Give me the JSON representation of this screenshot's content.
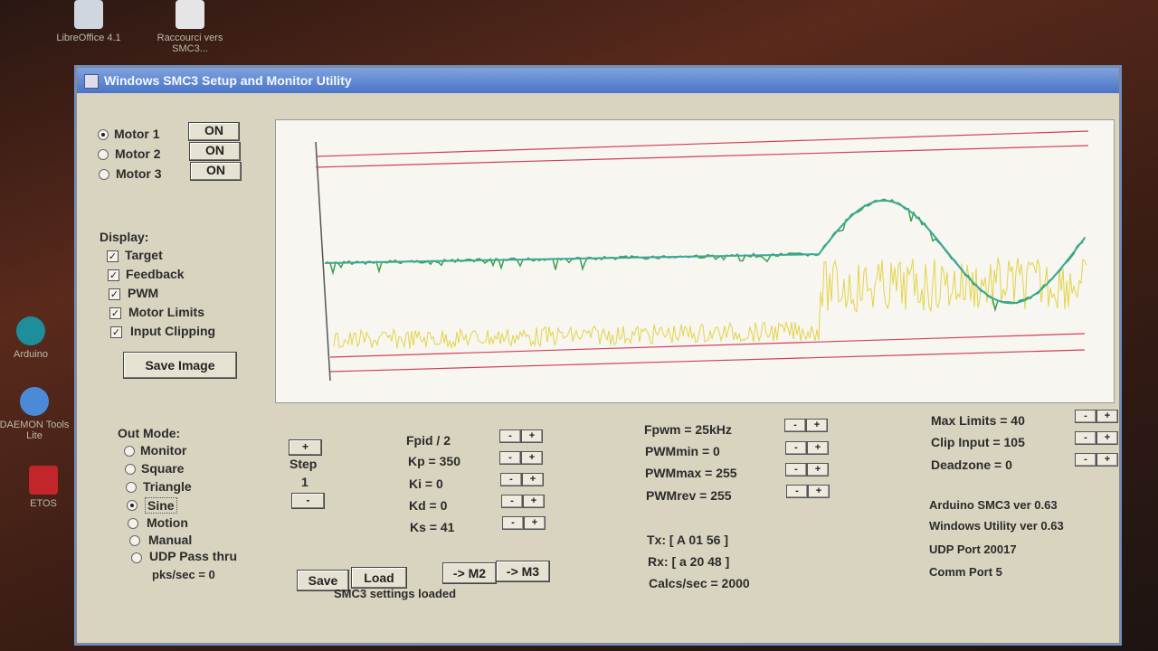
{
  "desktop": {
    "icons": [
      {
        "label": "LibreOffice 4.1"
      },
      {
        "label": "Raccourci vers SMC3..."
      },
      {
        "label": "Arduino"
      },
      {
        "label": "DAEMON Tools Lite"
      },
      {
        "label": "ETOS"
      }
    ]
  },
  "window": {
    "title": "Windows SMC3 Setup and Monitor Utility"
  },
  "motors": [
    {
      "label": "Motor 1",
      "state": "ON",
      "selected": true
    },
    {
      "label": "Motor 2",
      "state": "ON",
      "selected": false
    },
    {
      "label": "Motor 3",
      "state": "ON",
      "selected": false
    }
  ],
  "display": {
    "heading": "Display:",
    "options": [
      "Target",
      "Feedback",
      "PWM",
      "Motor Limits",
      "Input Clipping"
    ],
    "save_image": "Save Image"
  },
  "out_mode": {
    "heading": "Out Mode:",
    "options": [
      "Monitor",
      "Square",
      "Triangle",
      "Sine",
      "Motion",
      "Manual",
      "UDP Pass thru"
    ],
    "selected": "Sine",
    "pks": "pks/sec = 0"
  },
  "step": {
    "plus": "+",
    "label": "Step",
    "value": "1",
    "minus": "-"
  },
  "pid": [
    "Fpid / 2",
    "Kp = 350",
    "Ki = 0",
    "Kd = 0",
    "Ks = 41"
  ],
  "pwm": [
    "Fpwm = 25kHz",
    "PWMmin = 0",
    "PWMmax = 255",
    "PWMrev = 255"
  ],
  "limits": [
    "Max Limits = 40",
    "Clip Input = 105",
    "Deadzone = 0"
  ],
  "comm": {
    "tx": "Tx: [ A 01 56 ]",
    "rx": "Rx: [ a 20 48 ]",
    "calcs": "Calcs/sec = 2000"
  },
  "info": [
    "Arduino SMC3 ver 0.63",
    "Windows Utility ver 0.63",
    "UDP Port 20017",
    "Comm Port 5"
  ],
  "buttons": {
    "save": "Save",
    "load": "Load",
    "m2": "-> M2",
    "m3": "-> M3",
    "plus": "+",
    "minus": "-"
  },
  "status": "SMC3 settings loaded",
  "colors": {
    "target": "#3aa89a",
    "feedback": "#3f9f4a",
    "pwm": "#e3d34a",
    "limits": "#d2405a",
    "titlebar": "#4a74c8"
  }
}
